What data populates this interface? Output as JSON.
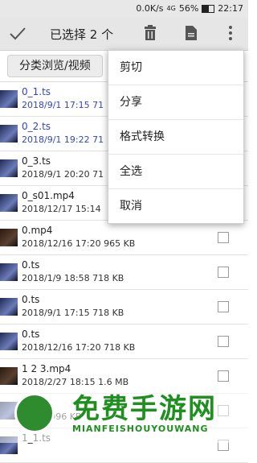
{
  "status_bar": {
    "speed": "0.0K/s",
    "signal": "4G",
    "battery": "56%",
    "battery_level": 0.56,
    "time": "22:17"
  },
  "topbar": {
    "title": "已选择 2 个"
  },
  "tabs": {
    "active_label": "分类浏览/视频"
  },
  "files": [
    {
      "name": "0_1.ts",
      "meta": "2018/9/1 17:15   71",
      "selected": true
    },
    {
      "name": "0_2.ts",
      "meta": "2018/9/1 19:22   71",
      "selected": true
    },
    {
      "name": "0_3.ts",
      "meta": "2018/9/1 20:20   71",
      "selected": false
    },
    {
      "name": "0_s01.mp4",
      "meta": "2018/12/17 15:14",
      "selected": false
    },
    {
      "name": "0.mp4",
      "meta": "2018/12/16 17:20   965 KB",
      "selected": false
    },
    {
      "name": "0.ts",
      "meta": "2018/1/9 18:58   718 KB",
      "selected": false
    },
    {
      "name": "0.ts",
      "meta": "2018/9/1 17:15   718 KB",
      "selected": false
    },
    {
      "name": "0.ts",
      "meta": "2018/12/16 17:20   718 KB",
      "selected": false
    },
    {
      "name": "1 2 3.mp4",
      "meta": "2018/2/27 18:15   1.6 MB",
      "selected": false
    },
    {
      "name": "",
      "meta": "20:20   996 KB",
      "selected": false
    },
    {
      "name": "1_1.ts",
      "meta": "",
      "selected": false
    }
  ],
  "menu": {
    "items": [
      "剪切",
      "分享",
      "格式转换",
      "全选",
      "取消"
    ]
  },
  "watermark": {
    "title": "免费手游网",
    "sub": "MIANFEISHOUYOUWANG"
  }
}
